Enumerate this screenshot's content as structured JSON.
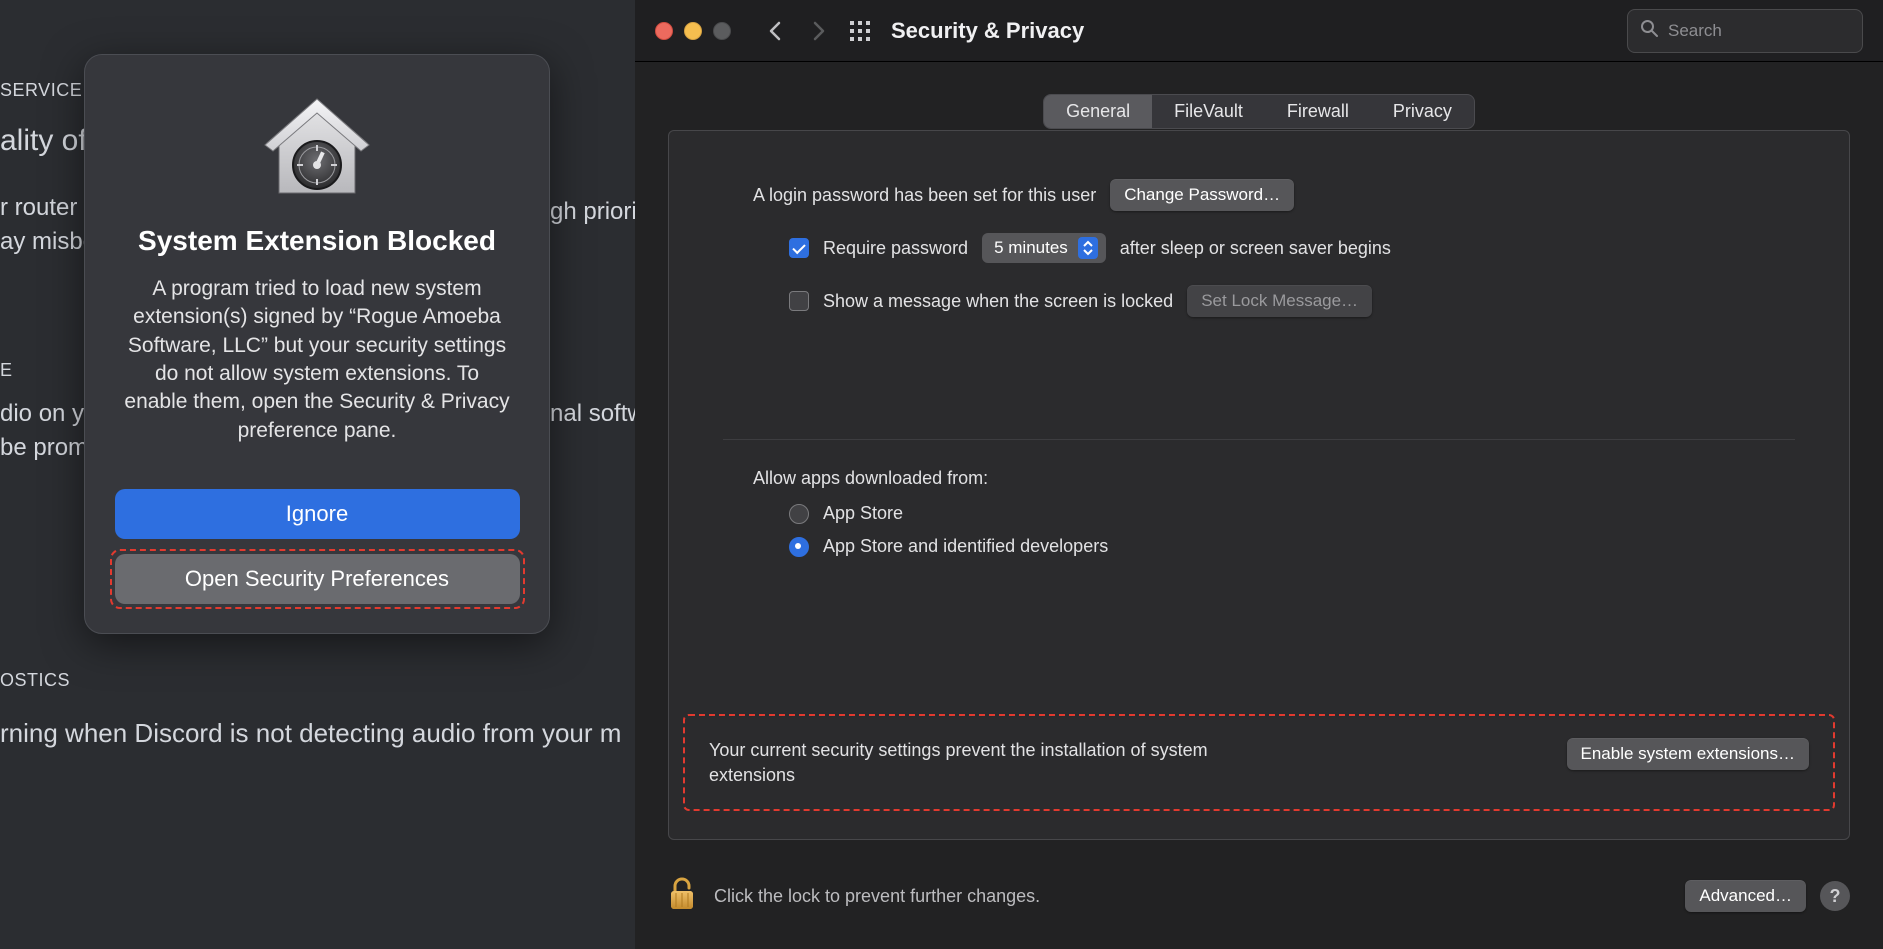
{
  "left_bg": {
    "heading_service": "SERVICE",
    "line_ality": "ality of S",
    "line_router": "r router t",
    "line_misbe": "ay misbe",
    "line_hp": "gh priori",
    "heading_e": "E",
    "line_dio": "dio on y",
    "line_prom": " be prom",
    "line_nal": "nal softw",
    "heading_diag": "OSTICS",
    "line_discord": "rning when Discord is not detecting audio from your m"
  },
  "sheet": {
    "title": "System Extension Blocked",
    "body": "A program tried to load new system extension(s) signed by “Rogue Amoeba Software, LLC” but your security settings do not allow system extensions. To enable them, open the Security & Privacy preference pane.",
    "ignore": "Ignore",
    "open": "Open Security Preferences"
  },
  "prefs": {
    "title": "Security & Privacy",
    "search_placeholder": "Search",
    "tabs": [
      "General",
      "FileVault",
      "Firewall",
      "Privacy"
    ],
    "active_tab": 0,
    "login_msg": "A login password has been set for this user",
    "change_pw": "Change Password…",
    "req_pw_label": "Require password",
    "delay_value": "5 minutes",
    "after_label": "after sleep or screen saver begins",
    "show_msg_label": "Show a message when the screen is locked",
    "set_lock_msg": "Set Lock Message…",
    "allow_heading": "Allow apps downloaded from:",
    "opt_appstore": "App Store",
    "opt_identified": "App Store and identified developers",
    "notice_msg": "Your current security settings prevent the installation of system extensions",
    "enable_btn": "Enable system extensions…",
    "lock_msg": "Click the lock to prevent further changes.",
    "advanced": "Advanced…"
  }
}
